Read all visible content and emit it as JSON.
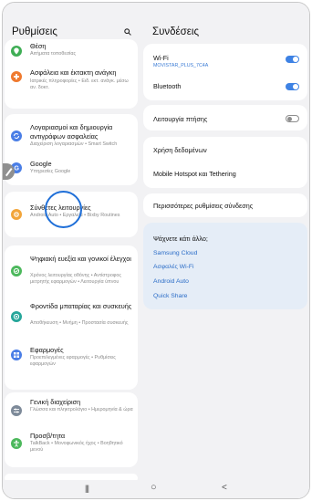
{
  "left_panel": {
    "title": "Ρυθμίσεις",
    "items": [
      {
        "title": "Θέση",
        "subtitle": "Αιτήματα τοποθεσίας",
        "color": "#3fae55"
      },
      {
        "title": "Ασφάλεια και έκτακτη ανάγκη",
        "subtitle": "Ιατρικές πληροφορίες • Ειδ. εκτ. ανάγκ. μέσω αν. δοκτ.",
        "color": "#ef7a2f"
      },
      {
        "title": "Λογαριασμοί και δημιουργία αντιγράφων ασφαλείας",
        "subtitle": "Διαχείριση λογαριασμών • Smart Switch",
        "color": "#4a7ee6"
      },
      {
        "title": "Google",
        "subtitle": "Υπηρεσίες Google",
        "color": "#4a7ee6"
      },
      {
        "title": "Σύνθετες λειτουργίες",
        "subtitle": "Android Auto • Εργαλεία • Bixby Routines",
        "color": "#f2a53a"
      },
      {
        "title": "Ψηφιακή ευεξία και γονικοί έλεγχοι",
        "subtitle": "Χρόνος λειτουργίας οθόνης • Αντίστροφος μετρητής εφαρμογών • Λειτουργία ύπνου",
        "color": "#4cb85c"
      },
      {
        "title": "Φροντίδα μπαταρίας και συσκευής",
        "subtitle": "Αποθήκευση • Μνήμη • Προστασία συσκευής",
        "color": "#26a69a"
      },
      {
        "title": "Εφαρμογές",
        "subtitle": "Προεπιλεγμένες εφαρμογές • Ρυθμίσεις εφαρμογών",
        "color": "#4a7ee6"
      },
      {
        "title": "Γενική διαχείριση",
        "subtitle": "Γλώσσα και πληκτρολόγιο • Ημερομηνία & ώρα",
        "color": "#7d8a99"
      },
      {
        "title": "Προσβ/τητα",
        "subtitle": "TalkBack • Μονοφωνικός ήχος • Βοηθητικό μενού",
        "color": "#4cb85c"
      }
    ]
  },
  "right_panel": {
    "title": "Συνδέσεις",
    "wifi": {
      "label": "Wi-Fi",
      "network": "MOVISTAR_PLUS_7C4A"
    },
    "bluetooth": {
      "label": "Bluetooth"
    },
    "flight_mode": {
      "label": "Λειτουργία πτήσης"
    },
    "data_usage": {
      "label": "Χρήση δεδομένων"
    },
    "hotspot": {
      "label": "Mobile Hotspot και Tethering"
    },
    "more": {
      "label": "Περισσότερες ρυθμίσεις σύνδεσης"
    },
    "suggestions": {
      "heading": "Ψάχνετε κάτι άλλο;",
      "links": [
        "Samsung Cloud",
        "Ασφαλές Wi-Fi",
        "Android Auto",
        "Quick Share"
      ]
    }
  },
  "nav": {
    "recents": "|||",
    "home": "○",
    "back": "<"
  }
}
